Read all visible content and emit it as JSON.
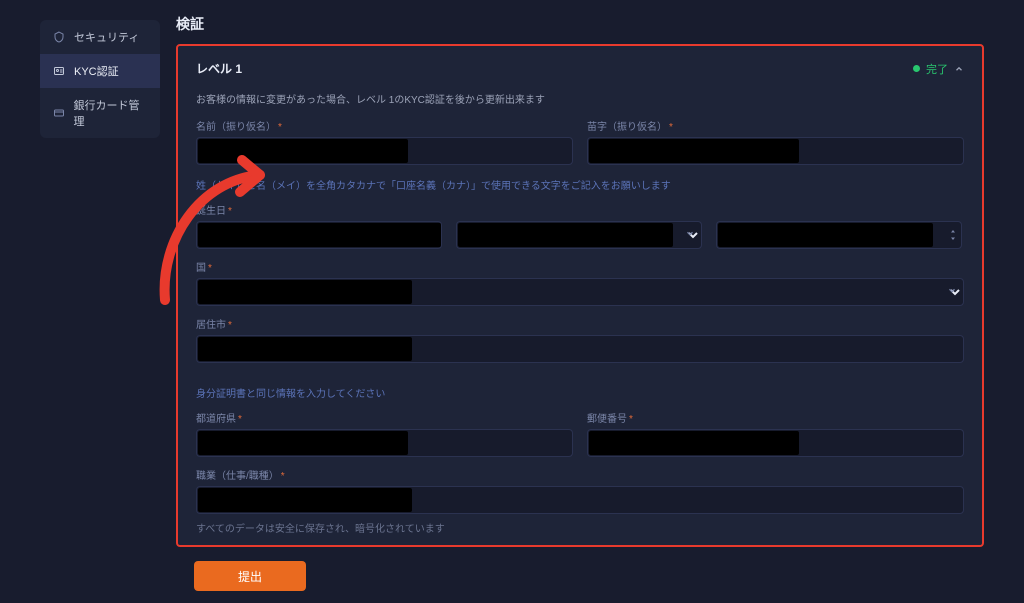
{
  "sidebar": {
    "items": [
      {
        "label": "セキュリティ",
        "icon": "shield-icon"
      },
      {
        "label": "KYC認証",
        "icon": "id-card-icon"
      },
      {
        "label": "銀行カード管理",
        "icon": "card-icon"
      }
    ]
  },
  "page": {
    "title": "検証"
  },
  "panel": {
    "title": "レベル 1",
    "status_label": "完了",
    "status_color": "#29c76f",
    "description": "お客様の情報に変更があった場合、レベル 1のKYC認証を後から更新出来ます",
    "name_hint": "姓（セイ）と名（メイ）を全角カタカナで「口座名義（カナ）」で使用できる文字をご記入をお願いします",
    "id_hint": "身分証明書と同じ情報を入力してください",
    "footer": "すべてのデータは安全に保存され、暗号化されています"
  },
  "fields": {
    "first_name": {
      "label": "名前（振り仮名）"
    },
    "last_name": {
      "label": "苗字（振り仮名）"
    },
    "birthdate": {
      "label": "誕生日"
    },
    "country": {
      "label": "国"
    },
    "city": {
      "label": "居住市"
    },
    "prefecture": {
      "label": "都道府県"
    },
    "postal": {
      "label": "郵便番号"
    },
    "occupation": {
      "label": "職業（仕事/職種）"
    }
  },
  "submit": {
    "label": "提出"
  },
  "annotation": {
    "arrow_color": "#e83a2d"
  }
}
